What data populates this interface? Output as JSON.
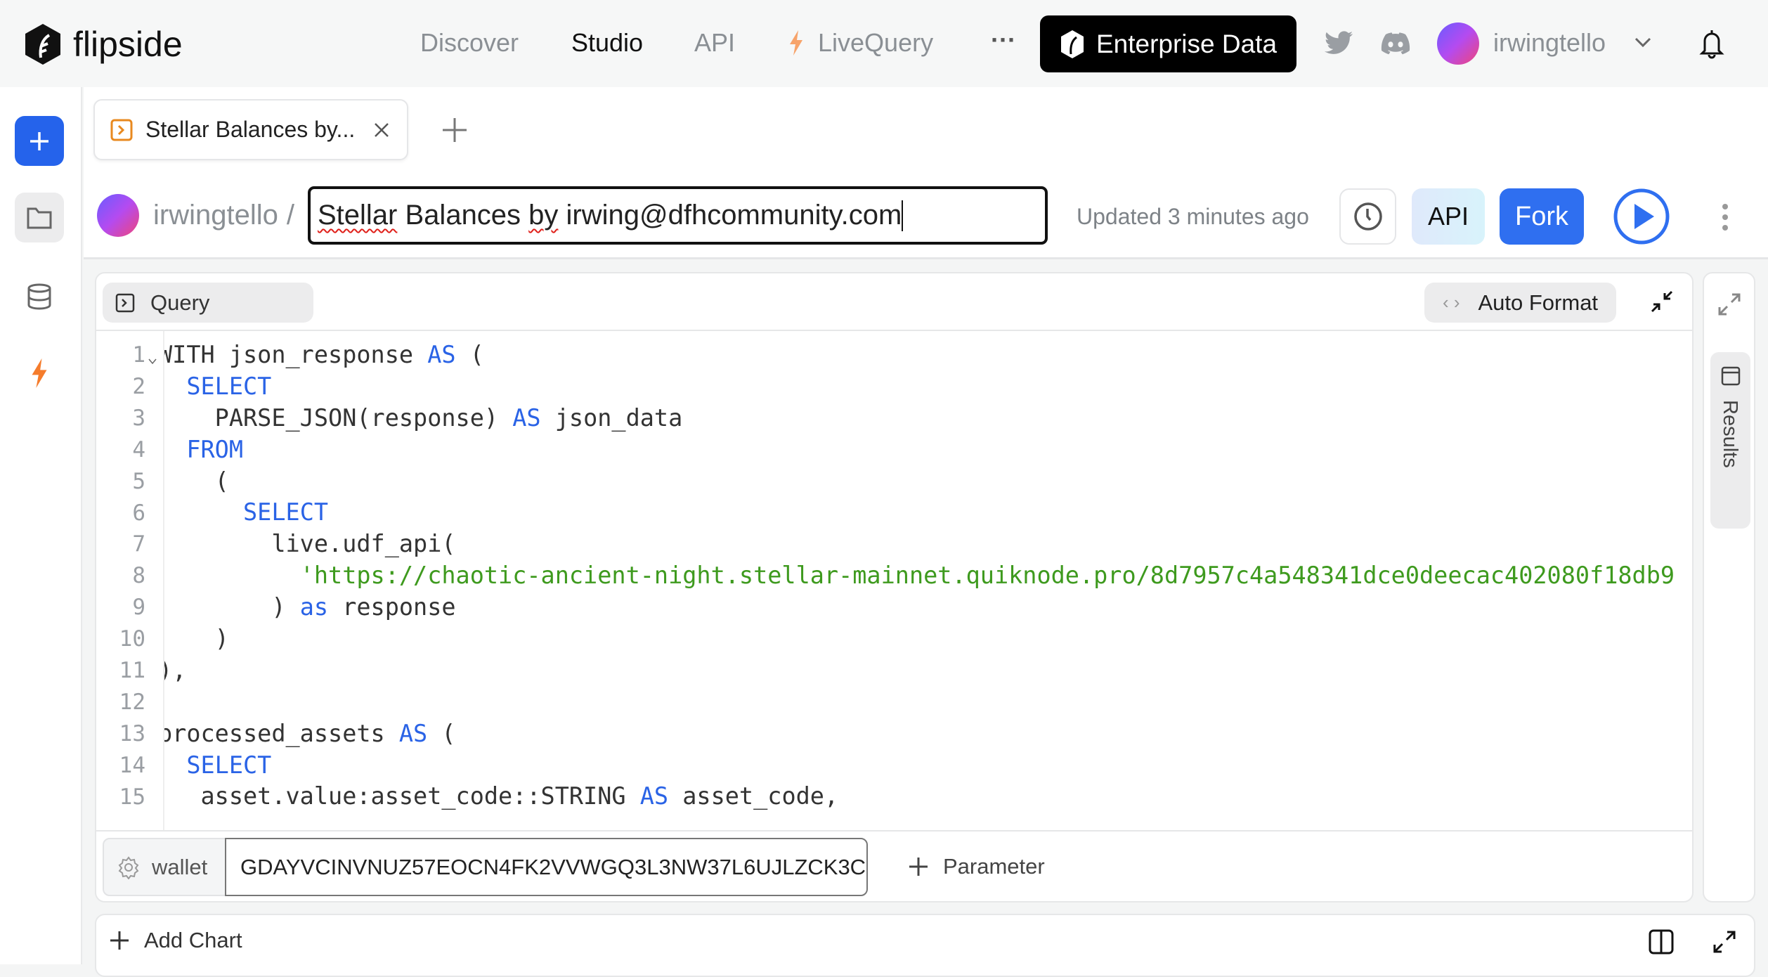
{
  "header": {
    "logo_text": "flipside",
    "nav": [
      {
        "label": "Discover"
      },
      {
        "label": "Studio",
        "active": true
      },
      {
        "label": "API"
      },
      {
        "label": "LiveQuery",
        "icon": "bolt-icon"
      }
    ],
    "more_label": "···",
    "enterprise_label": "Enterprise Data",
    "username": "irwingtello"
  },
  "tabs": [
    {
      "label": "Stellar Balances by...",
      "icon": "query-icon"
    }
  ],
  "query": {
    "owner": "irwingtello",
    "separator": "/",
    "title": "Stellar Balances by irwing@dfhcommunity.com",
    "title_misspelled": [
      "Stellar",
      "by"
    ],
    "updated": "Updated 3 minutes ago",
    "api_label": "API",
    "fork_label": "Fork"
  },
  "editor": {
    "tab_label": "Query",
    "auto_format_label": "Auto Format",
    "results_label": "Results",
    "colors": {
      "keyword": "#2a63e6",
      "string": "#3e9a1e"
    },
    "lines": [
      [
        [
          "WITH json_response ",
          ""
        ],
        [
          "AS",
          "kw"
        ],
        [
          " (",
          ""
        ]
      ],
      [
        [
          "  ",
          ""
        ],
        [
          "SELECT",
          "kw"
        ]
      ],
      [
        [
          "    PARSE_JSON(response) ",
          ""
        ],
        [
          "AS",
          "kw"
        ],
        [
          " json_data",
          ""
        ]
      ],
      [
        [
          "  ",
          ""
        ],
        [
          "FROM",
          "kw"
        ]
      ],
      [
        [
          "    (",
          ""
        ]
      ],
      [
        [
          "      ",
          ""
        ],
        [
          "SELECT",
          "kw"
        ]
      ],
      [
        [
          "        live.udf_api(",
          ""
        ]
      ],
      [
        [
          "          ",
          ""
        ],
        [
          "'https://chaotic-ancient-night.stellar-mainnet.quiknode.pro/8d7957c4a548341dce0deecac402080f18db9",
          "str"
        ]
      ],
      [
        [
          "        ) ",
          ""
        ],
        [
          "as",
          "kw"
        ],
        [
          " response",
          ""
        ]
      ],
      [
        [
          "    )",
          ""
        ]
      ],
      [
        [
          "),",
          ""
        ]
      ],
      [
        [
          "",
          ""
        ]
      ],
      [
        [
          "processed_assets ",
          ""
        ],
        [
          "AS",
          "kw"
        ],
        [
          " (",
          ""
        ]
      ],
      [
        [
          "  ",
          ""
        ],
        [
          "SELECT",
          "kw"
        ]
      ],
      [
        [
          "   asset.value:asset_code::STRING ",
          ""
        ],
        [
          "AS",
          "kw"
        ],
        [
          " asset_code,",
          ""
        ]
      ]
    ]
  },
  "parameters": [
    {
      "name": "wallet",
      "value": "GDAYVCINVNUZ57EOCN4FK2VVWGQ3L3NW37L6UJLZCK3C"
    }
  ],
  "add_parameter_label": "Parameter",
  "add_chart_label": "Add Chart"
}
